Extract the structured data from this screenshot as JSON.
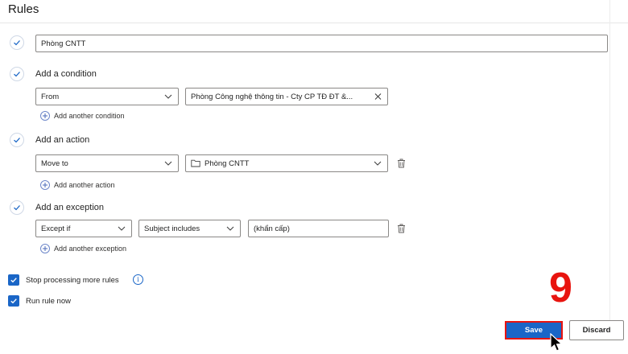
{
  "title": "Rules",
  "rule_name": "Phòng CNTT",
  "condition": {
    "label": "Add a condition",
    "field": "From",
    "value": "Phòng Công nghệ thông tin - Cty CP TĐ ĐT &...",
    "add_link": "Add another condition"
  },
  "action": {
    "label": "Add an action",
    "field": "Move to",
    "value": "Phòng CNTT",
    "add_link": "Add another action"
  },
  "exception": {
    "label": "Add an exception",
    "field": "Except if",
    "operator": "Subject includes",
    "value": "(khẩn cấp)",
    "add_link": "Add another exception"
  },
  "options": {
    "stop_processing": "Stop processing more rules",
    "run_now": "Run rule now",
    "info_glyph": "i"
  },
  "buttons": {
    "save": "Save",
    "discard": "Discard"
  },
  "annotation": {
    "step": "9"
  },
  "colors": {
    "accent": "#1a66c7",
    "highlight": "#e8140f"
  }
}
